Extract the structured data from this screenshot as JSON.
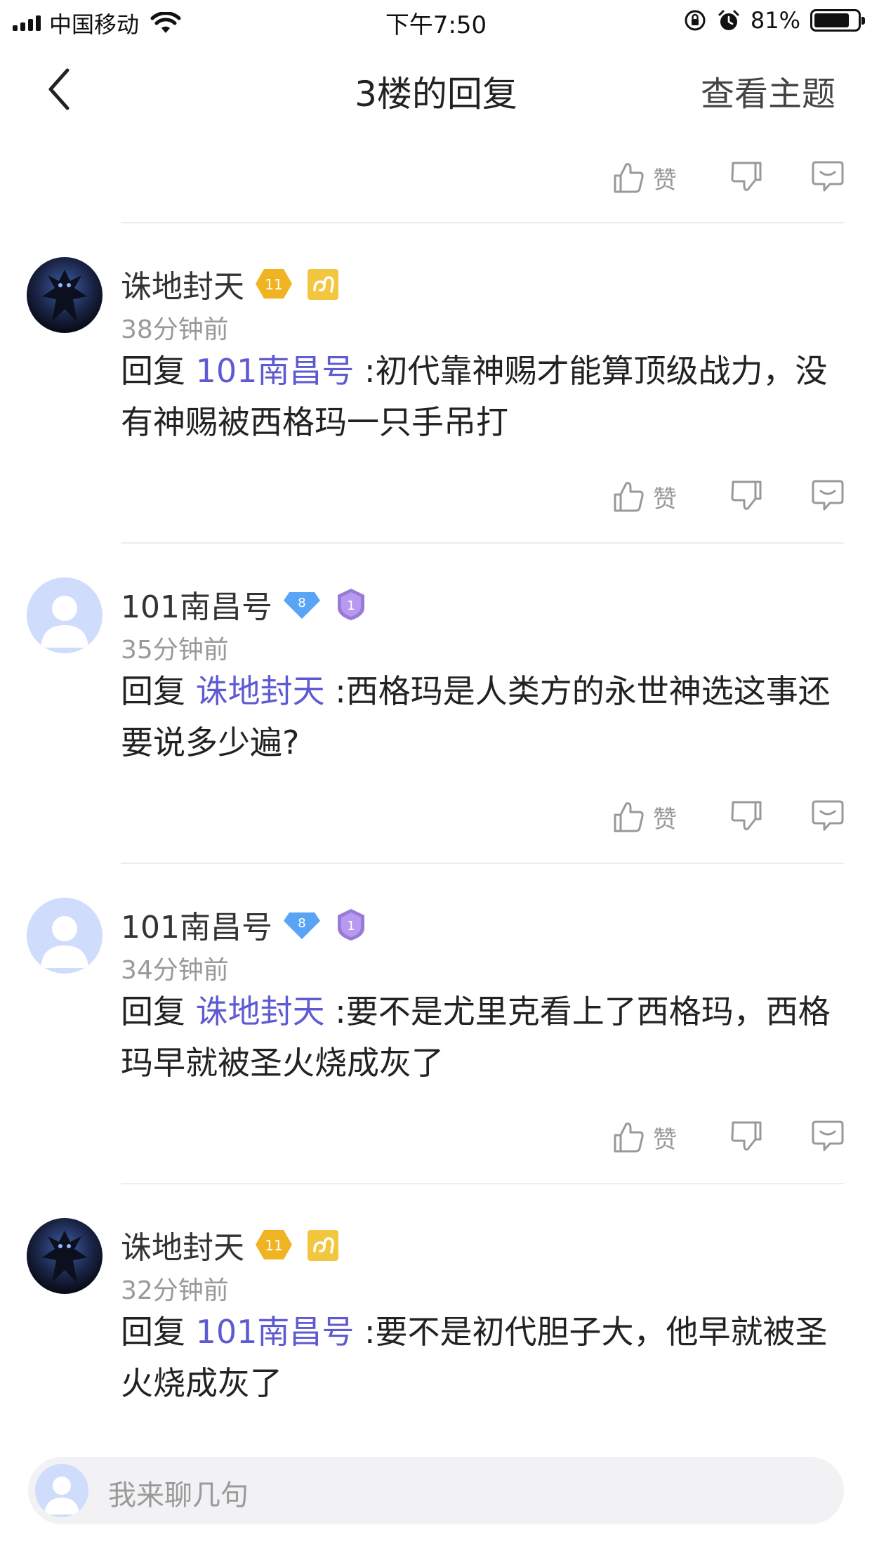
{
  "status_bar": {
    "carrier": "中国移动",
    "time": "下午7:50",
    "battery_pct": "81%",
    "battery_level": 0.81
  },
  "nav": {
    "title": "3楼的回复",
    "right_label": "查看主题"
  },
  "action_labels": {
    "like": "赞"
  },
  "replies": [
    {
      "user": "诛地封天",
      "level": "11",
      "avatar": "dark-creature-avatar",
      "time": "38分钟前",
      "prefix": "回复 ",
      "mention": "101南昌号",
      "text": " :初代靠神赐才能算顶级战力，没有神赐被西格玛一只手吊打"
    },
    {
      "user": "101南昌号",
      "level": "8",
      "avatar": "default-user-avatar",
      "time": "35分钟前",
      "prefix": "回复 ",
      "mention": "诛地封天",
      "text": " :西格玛是人类方的永世神选这事还要说多少遍?"
    },
    {
      "user": "101南昌号",
      "level": "8",
      "avatar": "default-user-avatar",
      "time": "34分钟前",
      "prefix": "回复 ",
      "mention": "诛地封天",
      "text": " :要不是尤里克看上了西格玛，西格玛早就被圣火烧成灰了"
    },
    {
      "user": "诛地封天",
      "level": "11",
      "avatar": "dark-creature-avatar",
      "time": "32分钟前",
      "prefix": "回复 ",
      "mention": "101南昌号",
      "text": " :要不是初代胆子大，他早就被圣火烧成灰了"
    }
  ],
  "input": {
    "placeholder": "我来聊几句"
  },
  "colors": {
    "mention": "#5e5ad2",
    "secondary_text": "#999999",
    "gold_badge": "#f0b423",
    "blue_badge": "#5aa4f5",
    "purple_badge": "#9a7ad8",
    "zodiac_badge": "#f3c640"
  }
}
